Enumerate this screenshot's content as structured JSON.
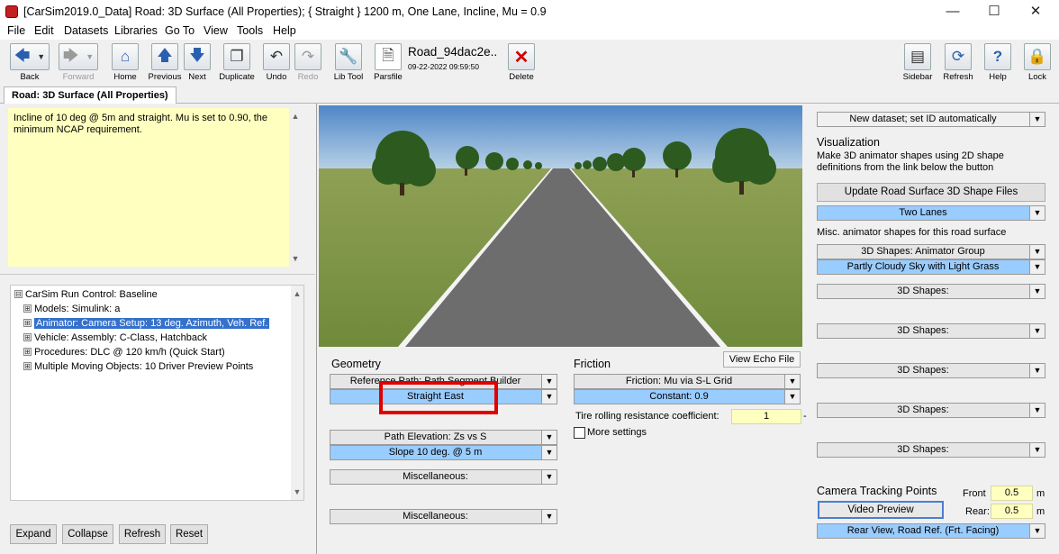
{
  "window": {
    "title": "[CarSim2019.0_Data] Road: 3D Surface (All Properties); { Straight } 1200 m, One Lane, Incline, Mu = 0.9",
    "minimize": "—",
    "maximize": "☐",
    "close": "✕"
  },
  "menu": [
    "File",
    "Edit",
    "Datasets",
    "Libraries",
    "Go To",
    "View",
    "Tools",
    "Help"
  ],
  "toolbar": {
    "back": "Back",
    "forward": "Forward",
    "home": "Home",
    "previous": "Previous",
    "next": "Next",
    "duplicate": "Duplicate",
    "undo": "Undo",
    "redo": "Redo",
    "lib_tool": "Lib Tool",
    "parsfile": "Parsfile",
    "dataset_name": "Road_94dac2e..",
    "dataset_date": "09-22-2022 09:59:50",
    "delete": "Delete",
    "sidebar": "Sidebar",
    "refresh": "Refresh",
    "help": "Help",
    "lock": "Lock"
  },
  "tab": "Road: 3D Surface (All Properties)",
  "notes": "Incline of 10 deg @ 5m and straight. Mu is set to  0.90, the minimum NCAP requirement.",
  "tree": [
    {
      "prefix": "⊟",
      "label": "CarSim Run Control: Baseline",
      "selected": false
    },
    {
      "prefix": "⊞",
      "label": "Models: Simulink: a",
      "selected": false
    },
    {
      "prefix": "⊞",
      "label": "Animator: Camera Setup: 13 deg. Azimuth, Veh. Ref.",
      "selected": true
    },
    {
      "prefix": "⊞",
      "label": "Vehicle: Assembly: C-Class, Hatchback",
      "selected": false
    },
    {
      "prefix": "⊞",
      "label": "Procedures: DLC @ 120 km/h (Quick Start)",
      "selected": false
    },
    {
      "prefix": "⊞",
      "label": "Multiple Moving Objects: 10 Driver Preview Points",
      "selected": false
    }
  ],
  "tree_buttons": {
    "expand": "Expand",
    "collapse": "Collapse",
    "refresh": "Refresh",
    "reset": "Reset"
  },
  "view_echo": "View Echo File",
  "geometry": {
    "heading": "Geometry",
    "ref_path": "Reference Path: Path Segment Builder",
    "ref_path_value": "Straight East",
    "elevation": "Path Elevation: Zs vs S",
    "elevation_value": "Slope 10 deg. @ 5 m",
    "misc1": "Miscellaneous:",
    "misc2": "Miscellaneous:"
  },
  "friction": {
    "heading": "Friction",
    "dropdown": "Friction: Mu via S-L Grid",
    "value": "Constant: 0.9",
    "trr_label": "Tire rolling resistance coefficient:",
    "trr_value": "1",
    "trr_unit": "-",
    "more_settings": "More settings"
  },
  "right": {
    "new_dataset": "New dataset; set ID automatically",
    "vis_heading": "Visualization",
    "vis_desc": "Make 3D animator shapes using 2D shape definitions from the link below the button",
    "update_btn": "Update Road Surface 3D Shape Files",
    "two_lanes": "Two Lanes",
    "misc_label": "Misc. animator shapes for this road surface",
    "group": "3D Shapes: Animator Group",
    "sky": "Partly Cloudy Sky with Light Grass",
    "shapes": [
      "3D Shapes:",
      "3D Shapes:",
      "3D Shapes:",
      "3D Shapes:",
      "3D Shapes:"
    ],
    "camera_heading": "Camera Tracking Points",
    "video_preview": "Video Preview",
    "front_label": "Front",
    "front_value": "0.5",
    "rear_label": "Rear:",
    "rear_value": "0.5",
    "unit_m": "m",
    "rear_view": "Rear View, Road Ref. (Frt. Facing)"
  },
  "colors": {
    "highlight_box": "#e00000",
    "blue_field": "#99ccff",
    "notes_bg": "#ffffc0"
  }
}
